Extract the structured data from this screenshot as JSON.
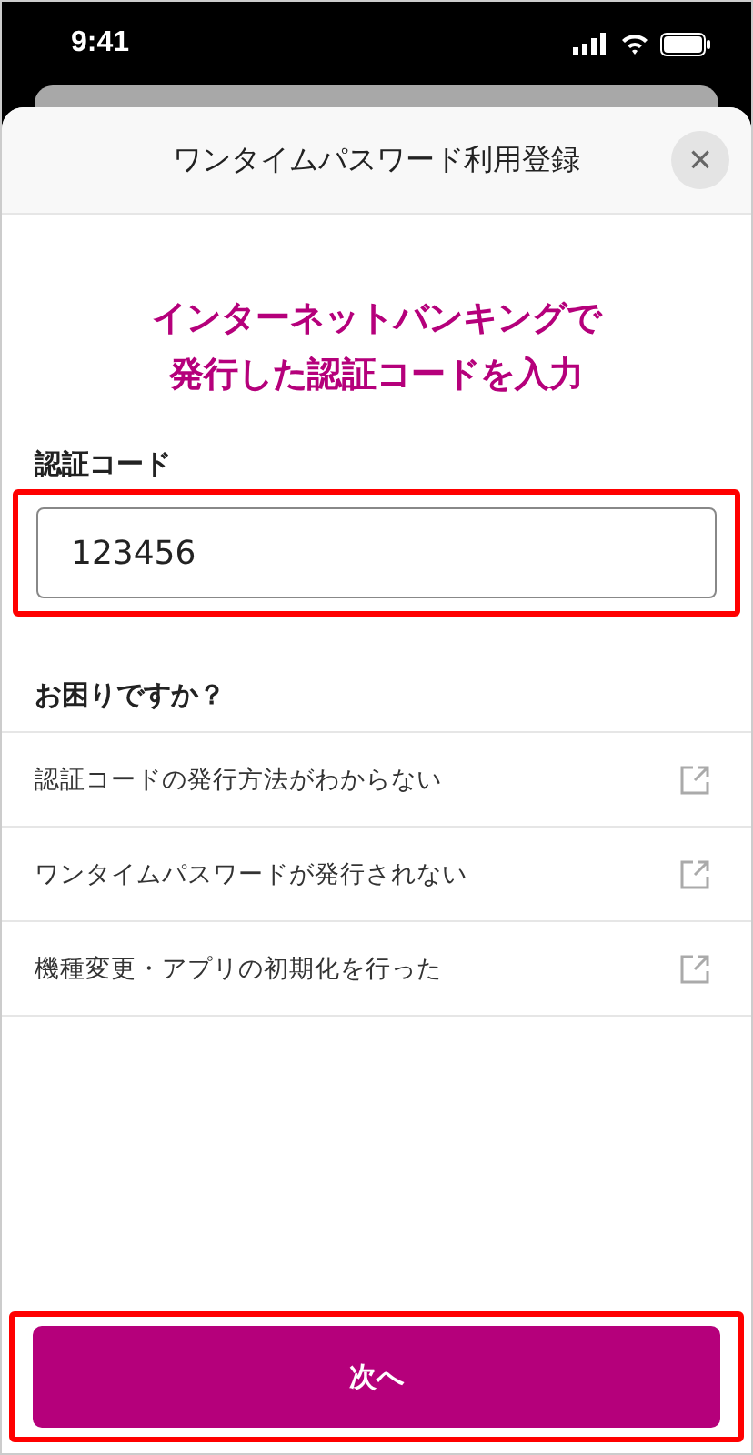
{
  "status_bar": {
    "time": "9:41"
  },
  "header": {
    "title": "ワンタイムパスワード利用登録",
    "close": "×"
  },
  "headline": [
    "インターネットバンキングで",
    "発行した認証コードを入力"
  ],
  "field": {
    "label": "認証コード",
    "value": "123456",
    "highlighted": true
  },
  "help": {
    "title": "お困りですか？",
    "links": [
      {
        "label": "認証コードの発行方法がわからない"
      },
      {
        "label": "ワンタイムパスワードが発行されない"
      },
      {
        "label": "機種変更・アプリの初期化を行った"
      }
    ]
  },
  "next_button": {
    "label": "次へ",
    "highlighted": true
  }
}
